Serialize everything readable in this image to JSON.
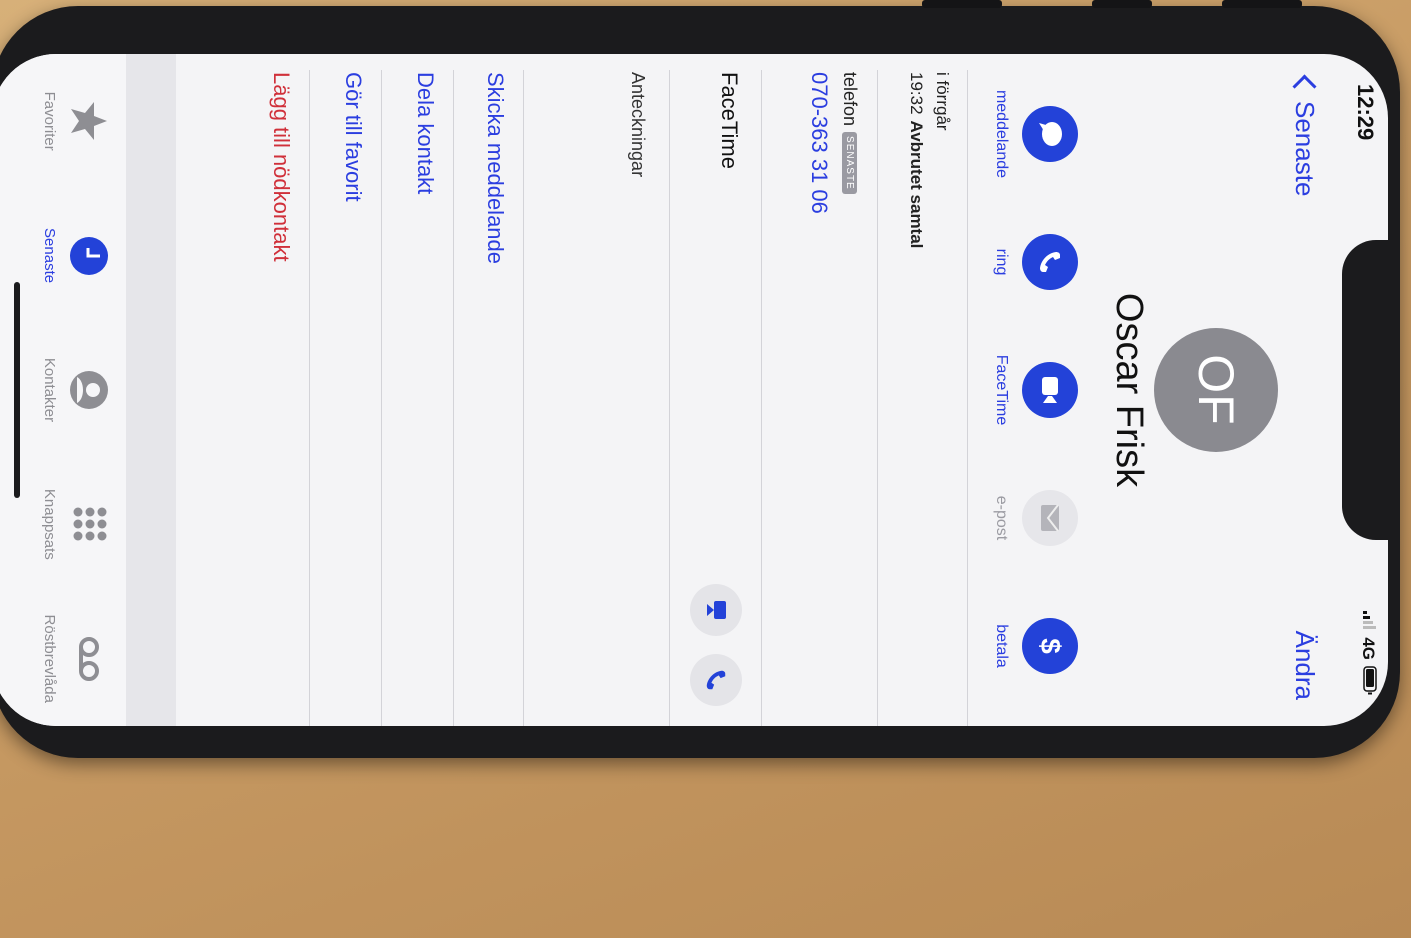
{
  "status": {
    "time": "12:29",
    "network": "4G"
  },
  "nav": {
    "back": "Senaste",
    "edit": "Ändra"
  },
  "contact": {
    "initials": "OF",
    "name": "Oscar Frisk"
  },
  "actions": [
    {
      "label": "meddelande",
      "icon": "message-icon",
      "enabled": true
    },
    {
      "label": "ring",
      "icon": "phone-icon",
      "enabled": true
    },
    {
      "label": "FaceTime",
      "icon": "video-icon",
      "enabled": true
    },
    {
      "label": "e-post",
      "icon": "mail-icon",
      "enabled": false
    },
    {
      "label": "betala",
      "icon": "dollar-icon",
      "enabled": true
    }
  ],
  "recent": {
    "day": "i förrgår",
    "time": "19:32",
    "description": "Avbrutet samtal"
  },
  "phone_entry": {
    "label": "telefon",
    "badge": "SENASTE",
    "number": "070-363 31 06"
  },
  "facetime": {
    "label": "FaceTime"
  },
  "notes": {
    "label": "Anteckningar"
  },
  "links": {
    "send_message": "Skicka meddelande",
    "share_contact": "Dela kontakt",
    "add_favorite": "Gör till favorit",
    "emergency": "Lägg till nödkontakt"
  },
  "tabs": [
    {
      "label": "Favoriter",
      "icon": "star-icon",
      "active": false
    },
    {
      "label": "Senaste",
      "icon": "clock-icon",
      "active": true
    },
    {
      "label": "Kontakter",
      "icon": "person-icon",
      "active": false
    },
    {
      "label": "Knappsats",
      "icon": "keypad-icon",
      "active": false
    },
    {
      "label": "Röstbrevlåda",
      "icon": "voicemail-icon",
      "active": false
    }
  ],
  "colors": {
    "accent": "#2342d8",
    "destructive": "#d0303a",
    "avatar": "#8a8a90"
  }
}
